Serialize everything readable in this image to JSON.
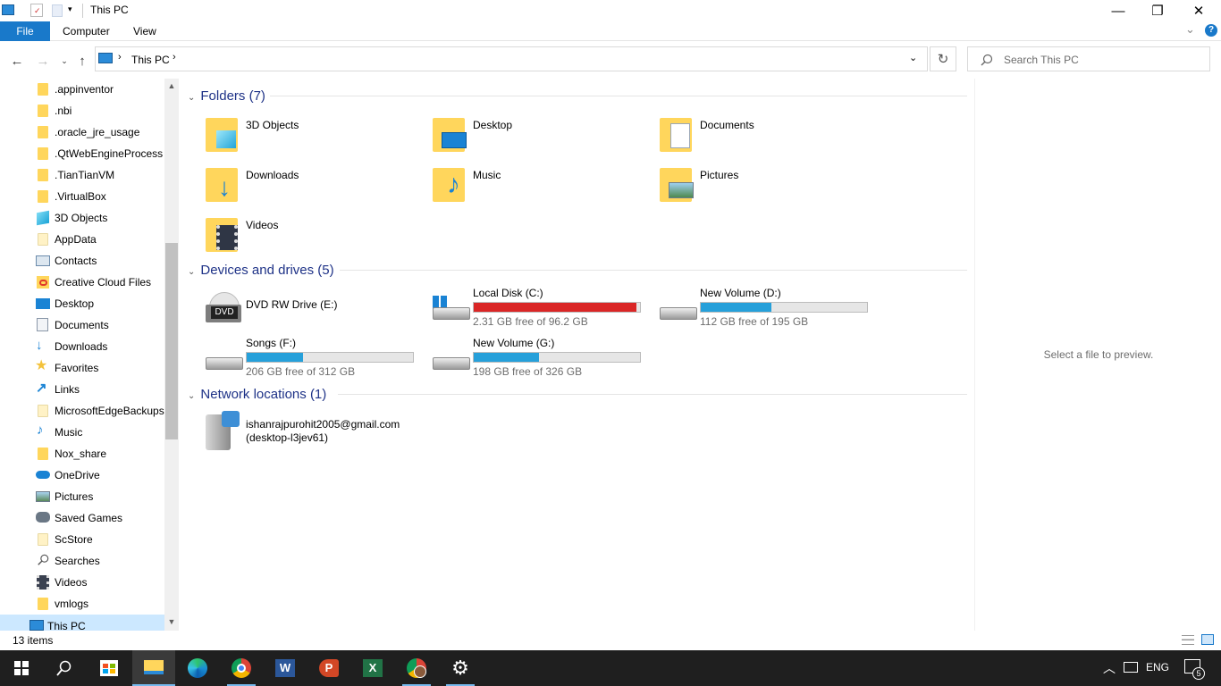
{
  "window": {
    "title": "This PC",
    "minimize_glyph": "—",
    "restore_glyph": "❐",
    "close_glyph": "✕"
  },
  "ribbon": {
    "tabs": [
      "File",
      "Computer",
      "View"
    ],
    "expand_glyph": "⌄",
    "help_glyph": "?"
  },
  "address": {
    "crumb": "This PC",
    "search_placeholder": "Search This PC"
  },
  "sidebar": {
    "items": [
      {
        "label": ".appinventor",
        "icon": "folder-icon"
      },
      {
        "label": ".nbi",
        "icon": "folder-icon"
      },
      {
        "label": ".oracle_jre_usage",
        "icon": "folder-icon"
      },
      {
        "label": ".QtWebEngineProcess",
        "icon": "folder-icon"
      },
      {
        "label": ".TianTianVM",
        "icon": "folder-icon"
      },
      {
        "label": ".VirtualBox",
        "icon": "folder-icon"
      },
      {
        "label": "3D Objects",
        "icon": "3d-objects-icon"
      },
      {
        "label": "AppData",
        "icon": "folder-icon"
      },
      {
        "label": "Contacts",
        "icon": "contacts-icon"
      },
      {
        "label": "Creative Cloud Files",
        "icon": "creative-cloud-icon"
      },
      {
        "label": "Desktop",
        "icon": "desktop-icon"
      },
      {
        "label": "Documents",
        "icon": "documents-icon"
      },
      {
        "label": "Downloads",
        "icon": "downloads-icon"
      },
      {
        "label": "Favorites",
        "icon": "star-icon"
      },
      {
        "label": "Links",
        "icon": "links-icon"
      },
      {
        "label": "MicrosoftEdgeBackups",
        "icon": "folder-icon"
      },
      {
        "label": "Music",
        "icon": "music-icon"
      },
      {
        "label": "Nox_share",
        "icon": "folder-icon"
      },
      {
        "label": "OneDrive",
        "icon": "onedrive-icon"
      },
      {
        "label": "Pictures",
        "icon": "pictures-icon"
      },
      {
        "label": "Saved Games",
        "icon": "saved-games-icon"
      },
      {
        "label": "ScStore",
        "icon": "folder-icon"
      },
      {
        "label": "Searches",
        "icon": "search-icon"
      },
      {
        "label": "Videos",
        "icon": "videos-icon"
      },
      {
        "label": "vmlogs",
        "icon": "folder-icon"
      },
      {
        "label": "This PC",
        "icon": "this-pc-icon"
      }
    ]
  },
  "groups": {
    "folders": {
      "title": "Folders (7)",
      "items": [
        "3D Objects",
        "Desktop",
        "Documents",
        "Downloads",
        "Music",
        "Pictures",
        "Videos"
      ]
    },
    "devices": {
      "title": "Devices and drives (5)",
      "items": [
        {
          "name": "DVD RW Drive (E:)",
          "free": "",
          "used_fraction": null,
          "dvd_label": "DVD"
        },
        {
          "name": "Local Disk (C:)",
          "free": "2.31 GB free of 96.2 GB",
          "used_fraction": 0.976
        },
        {
          "name": "New Volume (D:)",
          "free": "112 GB free of 195 GB",
          "used_fraction": 0.426
        },
        {
          "name": "Songs (F:)",
          "free": "206 GB free of 312 GB",
          "used_fraction": 0.34
        },
        {
          "name": "New Volume (G:)",
          "free": "198 GB free of 326 GB",
          "used_fraction": 0.393
        }
      ]
    },
    "network": {
      "title": "Network locations (1)",
      "item_line1": "ishanrajpurohit2005@gmail.com",
      "item_line2": "(desktop-l3jev61)"
    }
  },
  "preview": {
    "message": "Select a file to preview."
  },
  "status": {
    "count": "13 items"
  },
  "taskbar": {
    "language": "ENG",
    "notification_count": "5"
  }
}
